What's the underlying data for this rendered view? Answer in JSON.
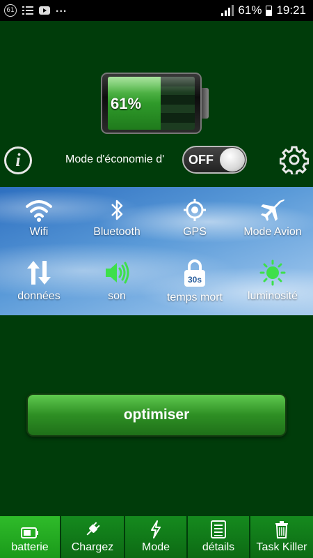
{
  "status_bar": {
    "notif_badge": "61",
    "notif_more": "...",
    "battery_percent": "61%",
    "time": "19:21"
  },
  "battery": {
    "level": 0.61,
    "label": "61%"
  },
  "power_saving": {
    "label": "Mode d'économie d'",
    "toggle_state": "OFF"
  },
  "quick_settings": [
    {
      "label": "Wifi",
      "icon": "wifi-icon"
    },
    {
      "label": "Bluetooth",
      "icon": "bluetooth-icon"
    },
    {
      "label": "GPS",
      "icon": "gps-icon"
    },
    {
      "label": "Mode Avion",
      "icon": "airplane-icon"
    },
    {
      "label": "données",
      "icon": "data-arrows-icon"
    },
    {
      "label": "son",
      "icon": "speaker-icon"
    },
    {
      "label": "temps mort",
      "icon": "lock-timer-icon",
      "badge": "30s"
    },
    {
      "label": "luminosité",
      "icon": "brightness-icon"
    }
  ],
  "optimize_button": "optimiser",
  "bottom_nav": [
    {
      "label": "batterie",
      "icon": "battery-icon",
      "active": true
    },
    {
      "label": "Chargez",
      "icon": "plug-icon"
    },
    {
      "label": "Mode",
      "icon": "lightning-icon"
    },
    {
      "label": "détails",
      "icon": "list-icon"
    },
    {
      "label": "Task Killer",
      "icon": "trash-icon"
    }
  ],
  "colors": {
    "background": "#003c0a",
    "accent_green": "#2fbb2a",
    "sound_icon": "#3ee04a",
    "brightness_icon": "#3ee04a"
  }
}
